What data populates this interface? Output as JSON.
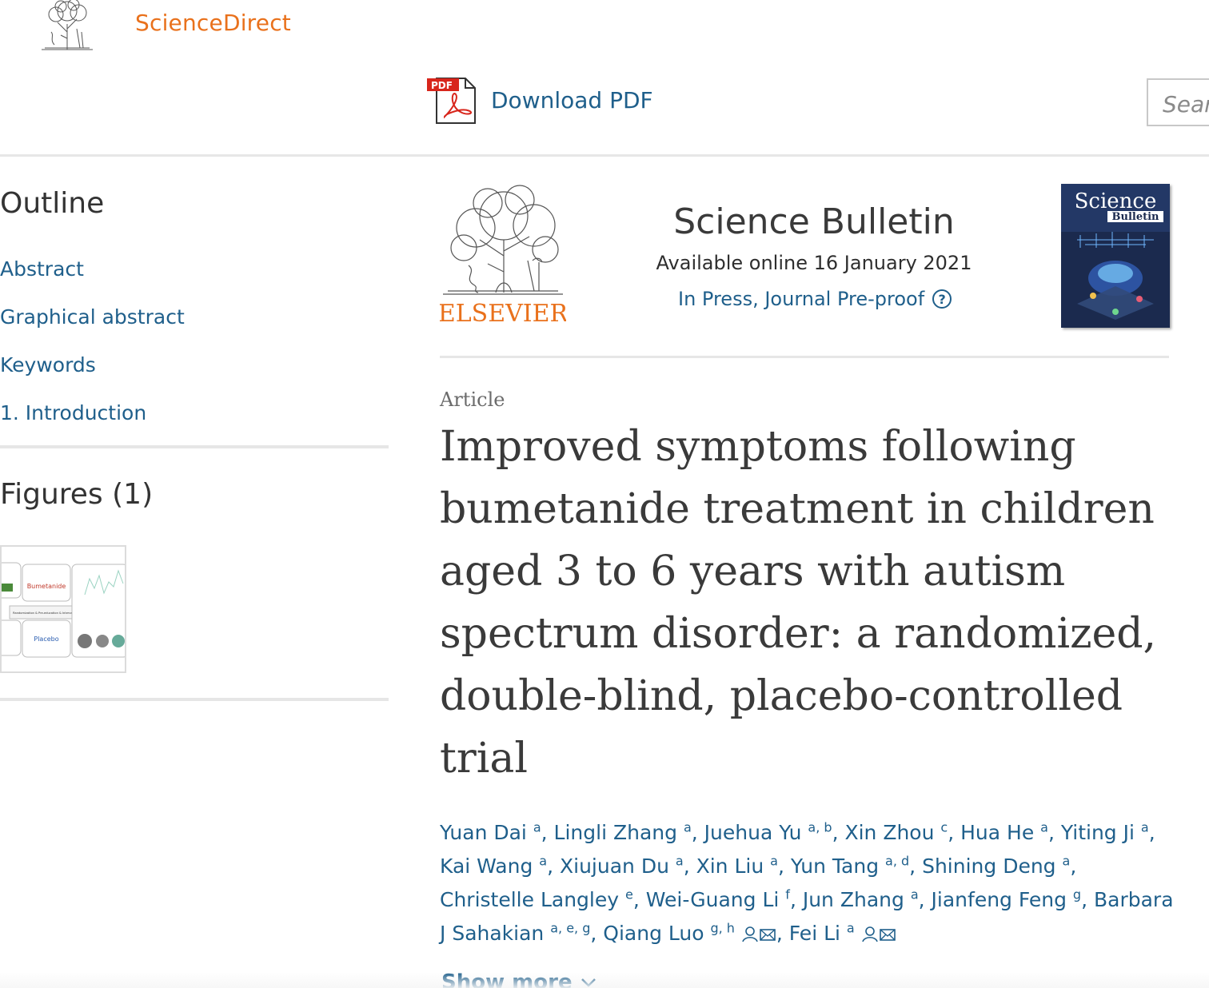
{
  "brand": {
    "name": "ScienceDirect",
    "logo_icon": "elsevier-tree-icon",
    "accent": "#e9711c"
  },
  "toolbar": {
    "download_label": "Download PDF",
    "pdf_badge": "PDF",
    "search_placeholder": "Sear"
  },
  "sidebar": {
    "outline_title": "Outline",
    "outline_items": [
      {
        "label": "Abstract"
      },
      {
        "label": "Graphical abstract"
      },
      {
        "label": "Keywords"
      },
      {
        "label": "1. Introduction"
      }
    ],
    "figures_title": "Figures (1)",
    "figure_thumb": {
      "box_top": "Bumetanide",
      "box_bottom": "Placebo",
      "center_label": "Randomization & Pre-education & Intervention"
    }
  },
  "journal": {
    "publisher": "ELSEVIER",
    "title": "Science Bulletin",
    "available_online": "Available online 16 January 2021",
    "status": "In Press, Journal Pre-proof",
    "help_glyph": "?",
    "cover_title_1": "Science",
    "cover_title_2": "Bulletin"
  },
  "article": {
    "type": "Article",
    "title": "Improved symptoms following bumetanide treatment in children aged 3 to 6 years with autism spectrum disorder: a randomized, double-blind, placebo-controlled trial",
    "authors": [
      {
        "name": "Yuan Dai",
        "aff": "a"
      },
      {
        "name": "Lingli Zhang",
        "aff": "a"
      },
      {
        "name": "Juehua Yu",
        "aff": "a, b"
      },
      {
        "name": "Xin Zhou",
        "aff": "c"
      },
      {
        "name": "Hua He",
        "aff": "a"
      },
      {
        "name": "Yiting Ji",
        "aff": "a"
      },
      {
        "name": "Kai Wang",
        "aff": "a"
      },
      {
        "name": "Xiujuan Du",
        "aff": "a"
      },
      {
        "name": "Xin Liu",
        "aff": "a"
      },
      {
        "name": "Yun Tang",
        "aff": "a, d"
      },
      {
        "name": "Shining Deng",
        "aff": "a"
      },
      {
        "name": "Christelle Langley",
        "aff": "e"
      },
      {
        "name": "Wei-Guang Li",
        "aff": "f"
      },
      {
        "name": "Jun Zhang",
        "aff": "a"
      },
      {
        "name": "Jianfeng Feng",
        "aff": "g"
      },
      {
        "name": "Barbara J Sahakian",
        "aff": "a, e, g"
      },
      {
        "name": "Qiang Luo",
        "aff": "g, h",
        "corresponding": true
      },
      {
        "name": "Fei Li",
        "aff": "a",
        "corresponding": true
      }
    ],
    "show_more": "Show more"
  },
  "colors": {
    "link": "#1f5f8b",
    "brand_orange": "#e9711c",
    "text": "#2e2e2e",
    "divider": "#e6e6e6"
  }
}
